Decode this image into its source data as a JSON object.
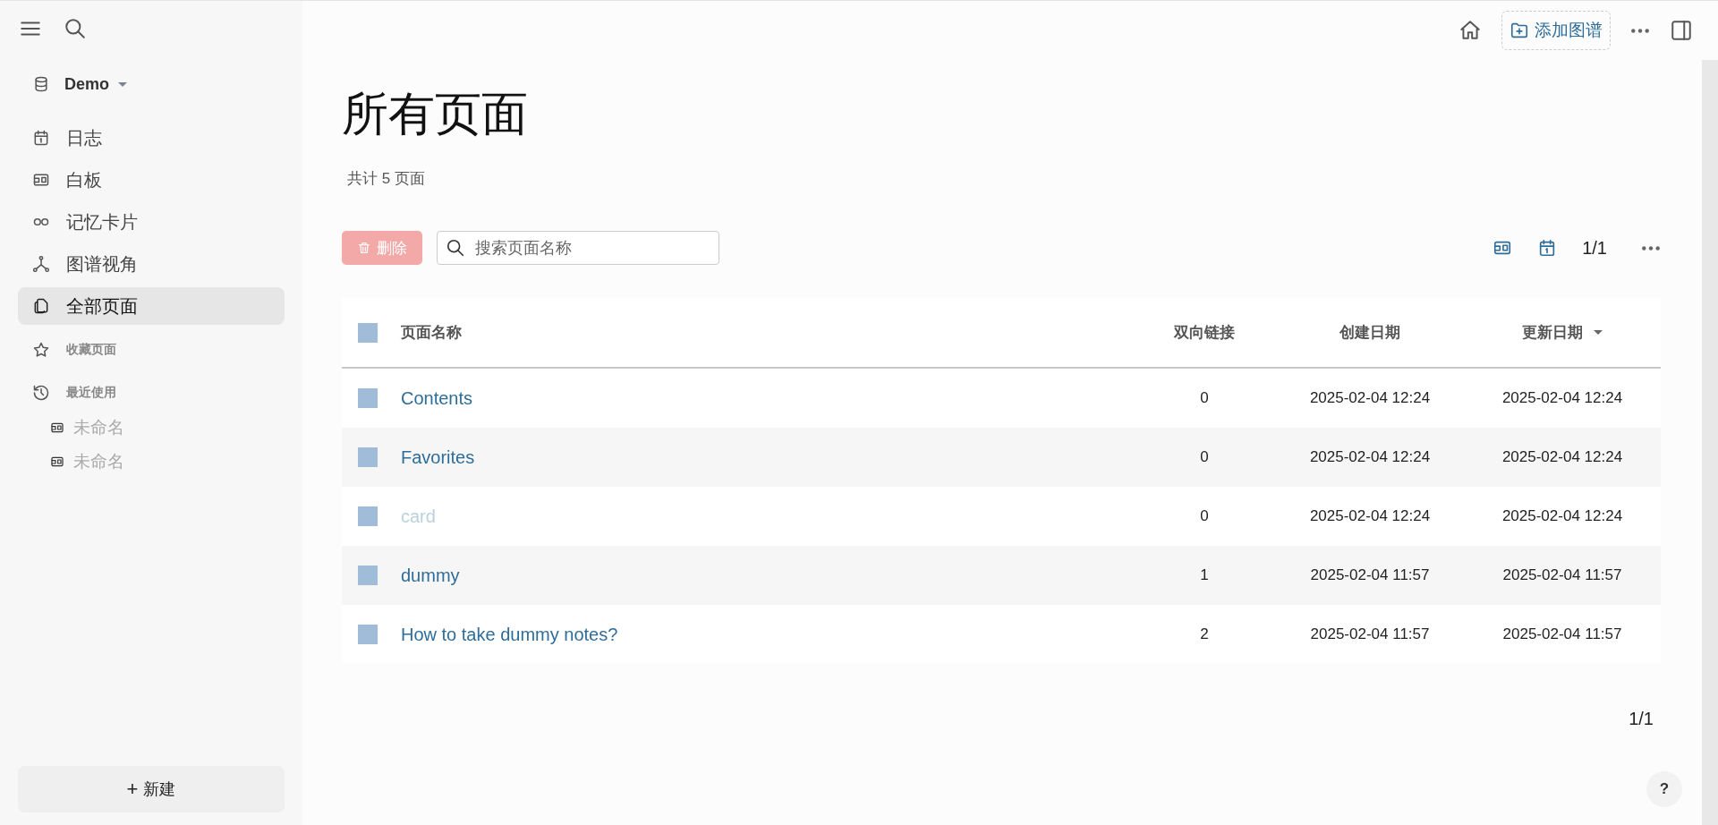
{
  "sidebar": {
    "graph": {
      "label": "Demo"
    },
    "nav": [
      {
        "label": "日志",
        "selected": false
      },
      {
        "label": "白板",
        "selected": false
      },
      {
        "label": "记忆卡片",
        "selected": false
      },
      {
        "label": "图谱视角",
        "selected": false
      },
      {
        "label": "全部页面",
        "selected": true
      }
    ],
    "favorites": {
      "label": "收藏页面"
    },
    "recent": {
      "label": "最近使用",
      "items": [
        {
          "label": "未命名"
        },
        {
          "label": "未命名"
        }
      ]
    },
    "new_button": {
      "icon": "+",
      "label": "新建"
    }
  },
  "header": {
    "add_graph": {
      "label": "添加图谱"
    }
  },
  "page": {
    "title": "所有页面",
    "count": "共计 5 页面",
    "toolbar": {
      "delete": {
        "label": "删除",
        "disabled": true
      },
      "search": {
        "placeholder": "搜索页面名称"
      },
      "pager": "1/1"
    },
    "table": {
      "header_checked": false,
      "columns": [
        {
          "label": "页面名称",
          "sorted": false
        },
        {
          "label": "双向链接",
          "sorted": false
        },
        {
          "label": "创建日期",
          "sorted": false
        },
        {
          "label": "更新日期",
          "sorted": true
        }
      ],
      "rows": [
        {
          "checked": false,
          "muted": false,
          "name": "Contents",
          "links": "0",
          "created": "2025-02-04 12:24",
          "updated": "2025-02-04 12:24"
        },
        {
          "checked": false,
          "muted": false,
          "name": "Favorites",
          "links": "0",
          "created": "2025-02-04 12:24",
          "updated": "2025-02-04 12:24"
        },
        {
          "checked": false,
          "muted": true,
          "name": "card",
          "links": "0",
          "created": "2025-02-04 12:24",
          "updated": "2025-02-04 12:24"
        },
        {
          "checked": false,
          "muted": false,
          "name": "dummy",
          "links": "1",
          "created": "2025-02-04 11:57",
          "updated": "2025-02-04 11:57"
        },
        {
          "checked": false,
          "muted": false,
          "name": "How to take dummy notes?",
          "links": "2",
          "created": "2025-02-04 11:57",
          "updated": "2025-02-04 11:57"
        }
      ]
    },
    "footer_pager": "1/1"
  },
  "help": {
    "label": "?"
  }
}
